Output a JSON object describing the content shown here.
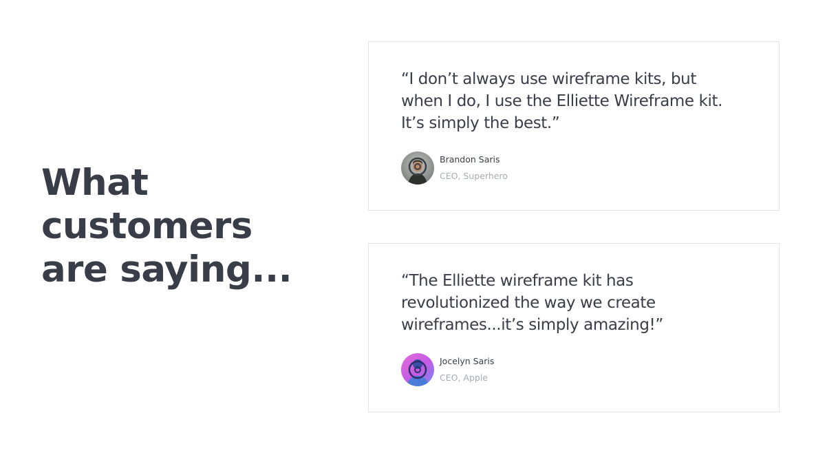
{
  "heading": {
    "lines": [
      "What",
      "customers",
      "are saying..."
    ]
  },
  "testimonials": [
    {
      "quote_lines": [
        "“I don’t always use wireframe kits, but",
        "when I do, I use the Elliette Wireframe kit.",
        "It’s simply the best.”"
      ],
      "author_name": "Brandon Saris",
      "author_role": "CEO, Superhero",
      "avatar_icon": "person-photo-avatar"
    },
    {
      "quote_lines": [
        "“The Elliette wireframe kit has",
        "revolutionized the way we create",
        "wireframes...it’s simply amazing!”"
      ],
      "author_name": "Jocelyn Saris",
      "author_role": "CEO, Apple",
      "avatar_icon": "person-photo-avatar"
    }
  ],
  "colors": {
    "text": "#383d47",
    "muted": "#a7abb4",
    "card_border": "#e3e4e8"
  }
}
